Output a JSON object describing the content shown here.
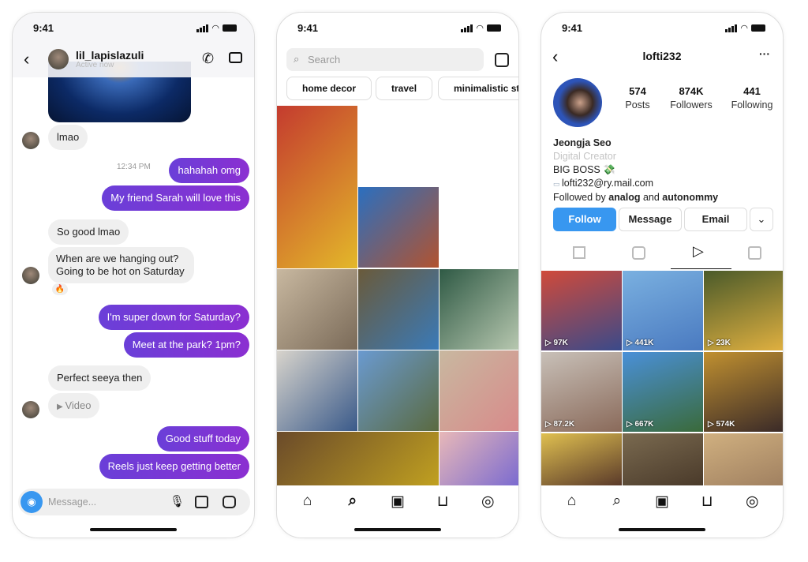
{
  "status_time": "9:41",
  "chat": {
    "username": "lil_lapislazuli",
    "status": "Active now",
    "messages": [
      {
        "side": "in",
        "text": "lmao"
      },
      {
        "side": "meta",
        "text": "12:34 PM"
      },
      {
        "side": "out",
        "text": "hahahah omg"
      },
      {
        "side": "out",
        "text": "My friend Sarah will love this"
      },
      {
        "side": "in",
        "text": "So good lmao"
      },
      {
        "side": "in",
        "text": "When are we hanging out?",
        "text2": "Going to be hot on Saturday"
      },
      {
        "side": "reaction",
        "text": "🔥"
      },
      {
        "side": "out",
        "text": "I'm super down for Saturday?"
      },
      {
        "side": "out",
        "text": "Meet at the park? 1pm?"
      },
      {
        "side": "in",
        "text": "Perfect seeya then"
      },
      {
        "side": "in",
        "text": "Video"
      },
      {
        "side": "out",
        "text": "Good stuff today"
      },
      {
        "side": "out",
        "text": "Reels just keep getting better"
      }
    ],
    "composer_placeholder": "Message..."
  },
  "explore": {
    "search_placeholder": "Search",
    "chips": [
      "home decor",
      "travel",
      "minimalistic sty"
    ]
  },
  "profile": {
    "username": "lofti232",
    "posts": "574",
    "posts_label": "Posts",
    "followers": "874K",
    "followers_label": "Followers",
    "following": "441",
    "following_label": "Following",
    "name": "Jeongja Seo",
    "category": "Digital Creator",
    "bio": "BIG BOSS 💸",
    "email": "lofti232@ry.mail.com",
    "followed_prefix": "Followed by ",
    "followed_a": "analog",
    "followed_and": " and ",
    "followed_b": "autonommy",
    "buttons": {
      "follow": "Follow",
      "message": "Message",
      "email": "Email"
    },
    "reel_views": [
      "97K",
      "441K",
      "23K",
      "87.2K",
      "667K",
      "574K"
    ]
  },
  "colors": {
    "accent": "#3897f0",
    "chat_out": "#7b35d6"
  }
}
